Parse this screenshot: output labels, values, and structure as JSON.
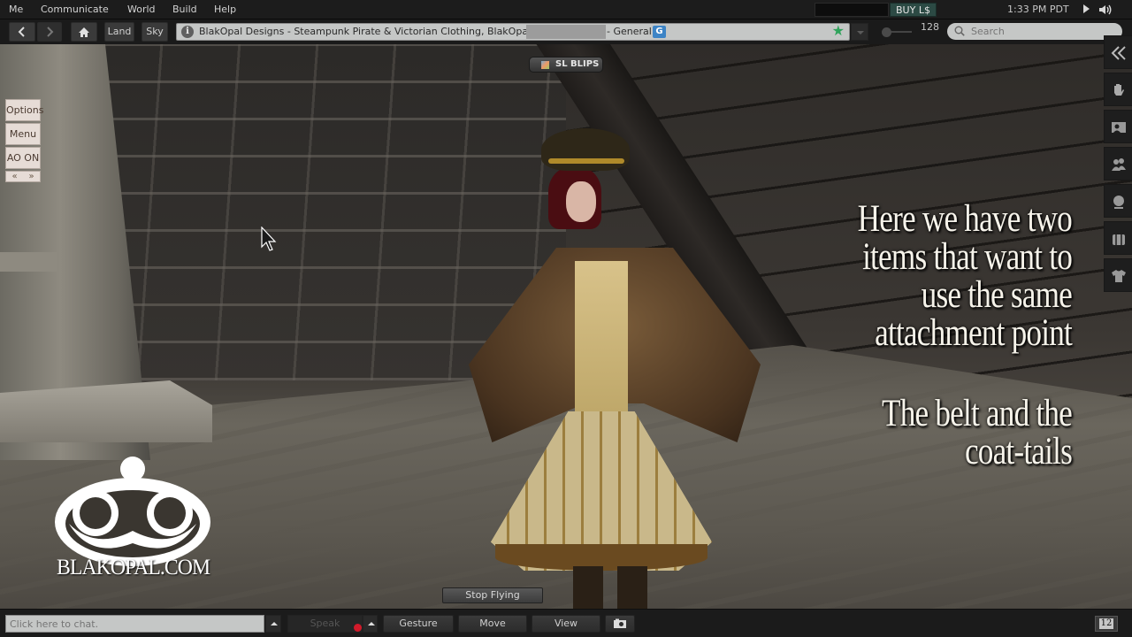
{
  "menubar": {
    "items": [
      "Me",
      "Communicate",
      "World",
      "Build",
      "Help"
    ],
    "buy_label": "BUY L$",
    "clock": "1:33 PM PDT"
  },
  "navbar": {
    "back_icon": "chevron-left-icon",
    "forward_icon": "chevron-right-icon",
    "home_icon": "home-icon",
    "land_label": "Land",
    "sky_label": "Sky",
    "location": {
      "text_before": "BlakOpal Designs - Steampunk Pirate & Victorian Clothing, BlakOpal",
      "text_after": "- General",
      "rating_badge": "G",
      "favorite_icon": "star-icon"
    },
    "draw_distance": "128",
    "search": {
      "placeholder": "Search",
      "value": ""
    }
  },
  "viewport": {
    "sl_blips_label": "SL BLIPS",
    "hud": {
      "options_label": "Options",
      "menu_label": "Menu",
      "ao_label": "AO ON",
      "prev_label": "«",
      "next_label": "»"
    },
    "caption": {
      "lines_1": [
        "Here we have two",
        "items that want to",
        "use the same",
        "attachment point"
      ],
      "lines_2": [
        "The belt and the",
        "coat-tails"
      ]
    },
    "logo_text": "BLAKOPAL.COM",
    "stop_flying_label": "Stop Flying"
  },
  "sidebar": {
    "items": [
      {
        "name": "collapse",
        "icon": "double-chevron-left-icon"
      },
      {
        "name": "home",
        "icon": "hand-icon"
      },
      {
        "name": "me",
        "icon": "profile-card-icon"
      },
      {
        "name": "people",
        "icon": "people-icon"
      },
      {
        "name": "places",
        "icon": "globe-icon"
      },
      {
        "name": "inventory",
        "icon": "suitcase-icon"
      },
      {
        "name": "appearance",
        "icon": "shirt-icon"
      }
    ]
  },
  "bottombar": {
    "chat_placeholder": "Click here to chat.",
    "chat_value": "",
    "speak_label": "Speak",
    "gesture_label": "Gesture",
    "move_label": "Move",
    "view_label": "View",
    "snapshot_icon": "camera-icon",
    "notification_count": "12"
  }
}
